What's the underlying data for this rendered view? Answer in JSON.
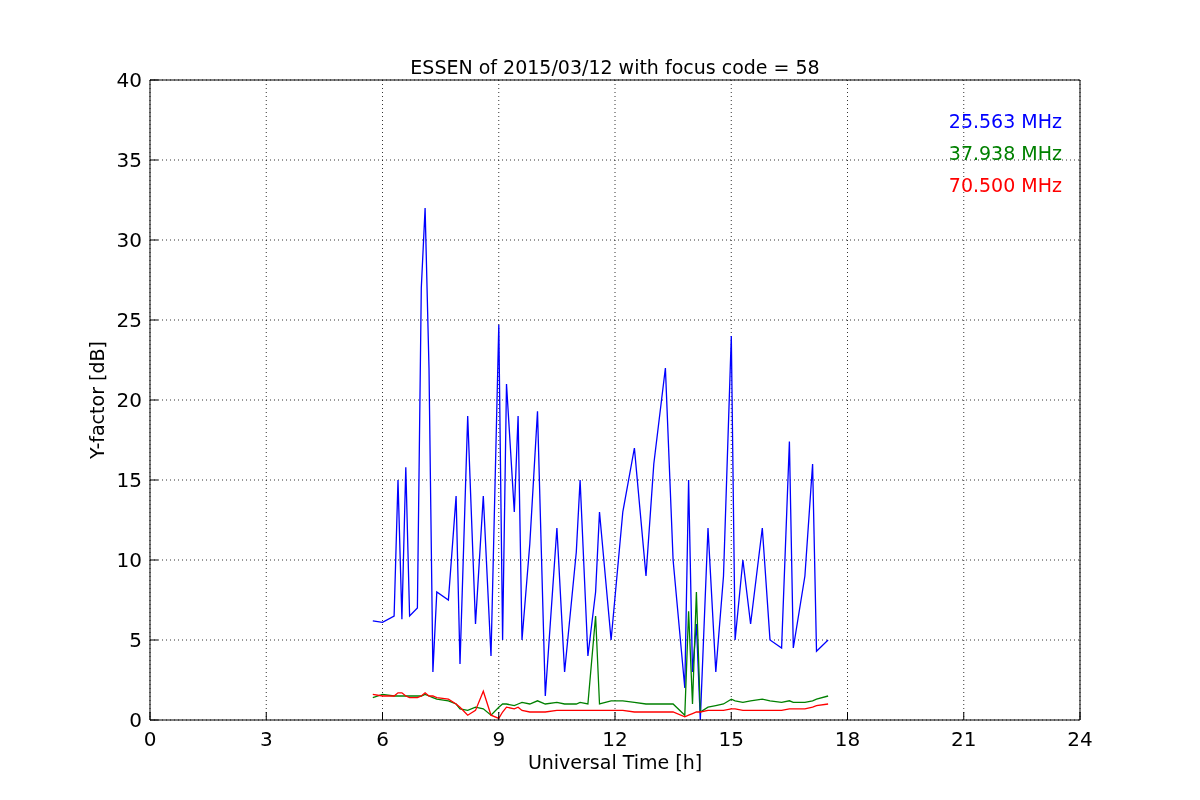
{
  "chart_data": {
    "type": "line",
    "grid": true,
    "title": "ESSEN of 2015/03/12 with focus code = 58",
    "xlabel": "Universal Time [h]",
    "ylabel": "Y-factor [dB]",
    "xlim": [
      0,
      24
    ],
    "ylim": [
      0,
      40
    ],
    "xticks": [
      0,
      3,
      6,
      9,
      12,
      15,
      18,
      21,
      24
    ],
    "yticks": [
      0,
      5,
      10,
      15,
      20,
      25,
      30,
      35,
      40
    ],
    "x": [
      5.75,
      6.0,
      6.3,
      6.4,
      6.5,
      6.6,
      6.7,
      6.9,
      7.0,
      7.1,
      7.2,
      7.3,
      7.4,
      7.7,
      7.9,
      8.0,
      8.2,
      8.4,
      8.6,
      8.8,
      9.0,
      9.1,
      9.2,
      9.4,
      9.5,
      9.6,
      9.8,
      10.0,
      10.2,
      10.5,
      10.7,
      11.0,
      11.1,
      11.3,
      11.5,
      11.6,
      11.9,
      12.2,
      12.5,
      12.8,
      13.0,
      13.3,
      13.5,
      13.8,
      13.9,
      14.0,
      14.1,
      14.2,
      14.4,
      14.6,
      14.8,
      15.0,
      15.1,
      15.3,
      15.5,
      15.8,
      16.0,
      16.3,
      16.5,
      16.6,
      16.9,
      17.1,
      17.2,
      17.5
    ],
    "series": [
      {
        "name": "25.563 MHz",
        "color": "#0000ff",
        "values": [
          6.2,
          6.1,
          6.5,
          15,
          6.3,
          15.8,
          6.5,
          7,
          27,
          32,
          22,
          3,
          8,
          7.5,
          14,
          3.5,
          19,
          6,
          14,
          4,
          24.7,
          5,
          21,
          13,
          19,
          5,
          11,
          19.3,
          1.5,
          12,
          3,
          10.5,
          15,
          4,
          8,
          13,
          5,
          13,
          17,
          9,
          16,
          22,
          10,
          2,
          15,
          3,
          6,
          0,
          12,
          3,
          9,
          24,
          5,
          10,
          6,
          12,
          5,
          4.5,
          17.4,
          4.5,
          9,
          16,
          4.3,
          5
        ]
      },
      {
        "name": "37.938 MHz",
        "color": "#008000",
        "values": [
          1.4,
          1.6,
          1.5,
          1.5,
          1.5,
          1.5,
          1.5,
          1.5,
          1.5,
          1.6,
          1.5,
          1.4,
          1.3,
          1.2,
          1.0,
          0.7,
          0.6,
          0.8,
          0.7,
          0.3,
          0.8,
          1.0,
          1.0,
          0.9,
          1.0,
          1.1,
          1.0,
          1.2,
          1.0,
          1.1,
          1.0,
          1.0,
          1.1,
          1.0,
          6.5,
          1.0,
          1.2,
          1.2,
          1.1,
          1.0,
          1.0,
          1.0,
          1.0,
          0.3,
          6.8,
          1.0,
          8.0,
          0.5,
          0.8,
          0.9,
          1.0,
          1.3,
          1.2,
          1.1,
          1.2,
          1.3,
          1.2,
          1.1,
          1.2,
          1.1,
          1.1,
          1.2,
          1.3,
          1.5
        ]
      },
      {
        "name": "70.500 MHz",
        "color": "#ff0000",
        "values": [
          1.6,
          1.5,
          1.5,
          1.7,
          1.7,
          1.5,
          1.4,
          1.4,
          1.5,
          1.7,
          1.5,
          1.5,
          1.4,
          1.3,
          1.0,
          0.8,
          0.3,
          0.6,
          1.8,
          0.3,
          0.1,
          0.5,
          0.8,
          0.7,
          0.8,
          0.6,
          0.5,
          0.5,
          0.5,
          0.6,
          0.6,
          0.6,
          0.6,
          0.6,
          0.6,
          0.6,
          0.6,
          0.6,
          0.5,
          0.5,
          0.5,
          0.5,
          0.5,
          0.2,
          0.3,
          0.4,
          0.5,
          0.5,
          0.6,
          0.6,
          0.6,
          0.7,
          0.7,
          0.6,
          0.6,
          0.6,
          0.6,
          0.6,
          0.7,
          0.7,
          0.7,
          0.8,
          0.9,
          1.0
        ]
      }
    ]
  }
}
